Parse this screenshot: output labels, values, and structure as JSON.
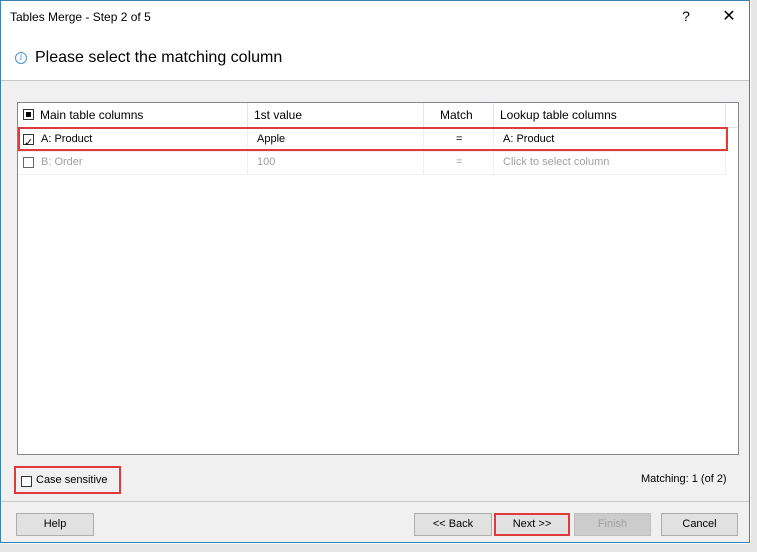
{
  "window": {
    "title": "Tables Merge - Step 2 of 5",
    "help_glyph": "?",
    "close_glyph": "✕"
  },
  "header": {
    "info_glyph": "i",
    "text": "Please select the matching column"
  },
  "table": {
    "columns": [
      "Main table columns",
      "1st value",
      "Match",
      "Lookup table columns"
    ],
    "rows": [
      {
        "checked": true,
        "main": "A: Product",
        "first_value": "Apple",
        "match": "=",
        "lookup": "A: Product"
      },
      {
        "checked": false,
        "main": "B: Order",
        "first_value": "100",
        "match": "=",
        "lookup": "Click to select column"
      }
    ]
  },
  "options": {
    "case_sensitive_label": "Case sensitive",
    "case_sensitive_checked": false
  },
  "status": {
    "matching": "Matching: 1 (of 2)"
  },
  "buttons": {
    "help": "Help",
    "back": "<< Back",
    "next": "Next >>",
    "finish": "Finish",
    "cancel": "Cancel"
  },
  "colors": {
    "highlight": "#e03a3a",
    "window_border": "#3c7fb1",
    "dialog_bg": "#f0f0f0"
  }
}
